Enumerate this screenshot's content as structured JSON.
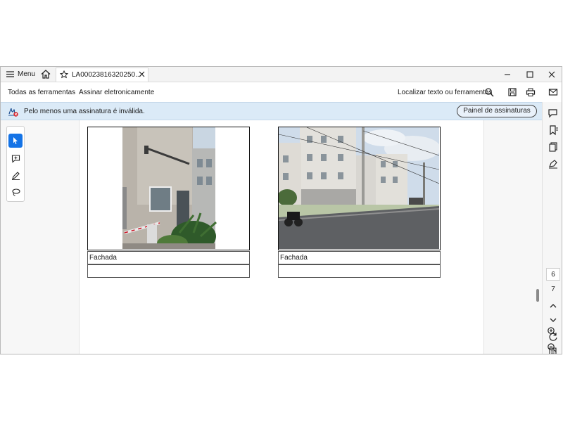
{
  "titlebar": {
    "menu_label": "Menu",
    "tab_title": "LA00023816320250..."
  },
  "toolbar": {
    "all_tools": "Todas as ferramentas",
    "sign": "Assinar eletronicamente",
    "find": "Localizar texto ou ferramentas"
  },
  "banner": {
    "message": "Pelo menos uma assinatura é inválida.",
    "panel_button": "Painel de assinaturas"
  },
  "document": {
    "photos": [
      {
        "caption": "Fachada"
      },
      {
        "caption": "Fachada"
      }
    ]
  },
  "pages": {
    "current": "6",
    "next": "7"
  },
  "colors": {
    "accent": "#1473e6",
    "banner_bg": "#dbeaf7"
  }
}
